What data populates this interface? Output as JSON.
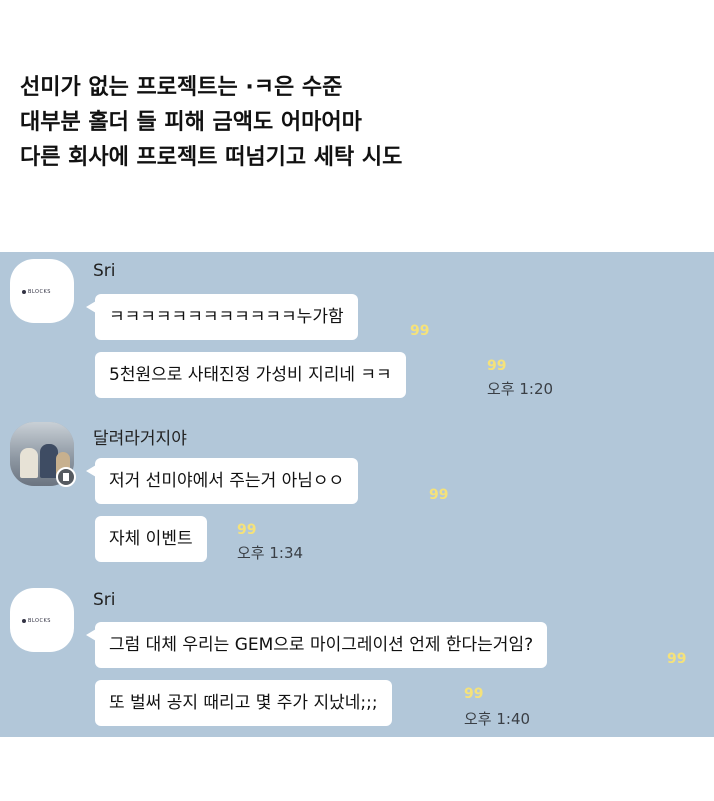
{
  "caption": {
    "line1": "선미가 없는 프로젝트는 ·ㅋ은 수준",
    "line2": "대부분 홀더 들 피해 금액도 어마어마",
    "line3": "다른 회사에 프로젝트 떠넘기고 세탁 시도"
  },
  "chat": {
    "groups": [
      {
        "sender": "Sri",
        "avatar_icon": "blocks-logo-icon",
        "avatar_text": "BLOCKS",
        "messages": [
          {
            "text": "ㅋㅋㅋㅋㅋㅋㅋㅋㅋㅋㅋㅋ누가함",
            "unread": "99",
            "time": ""
          },
          {
            "text": "5천원으로 사태진정 가성비 지리네 ㅋㅋ",
            "unread": "99",
            "time": "오후 1:20"
          }
        ]
      },
      {
        "sender": "달려라거지야",
        "avatar_icon": "profile-photo-icon",
        "messages": [
          {
            "text": "저거 선미야에서 주는거 아님ㅇㅇ",
            "unread": "99",
            "time": ""
          },
          {
            "text": "자체 이벤트",
            "unread": "99",
            "time": "오후 1:34"
          }
        ]
      },
      {
        "sender": "Sri",
        "avatar_icon": "blocks-logo-icon",
        "avatar_text": "BLOCKS",
        "messages": [
          {
            "text": "그럼 대체 우리는 GEM으로 마이그레이션 언제 한다는거임?",
            "unread": "99",
            "time": ""
          },
          {
            "text": "또 벌써 공지 때리고 몇 주가 지났네;;;",
            "unread": "99",
            "time": "오후 1:40"
          }
        ]
      }
    ]
  },
  "colors": {
    "chat_background": "#b2c7d9",
    "bubble": "#ffffff",
    "unread_count": "#f5e27a"
  }
}
